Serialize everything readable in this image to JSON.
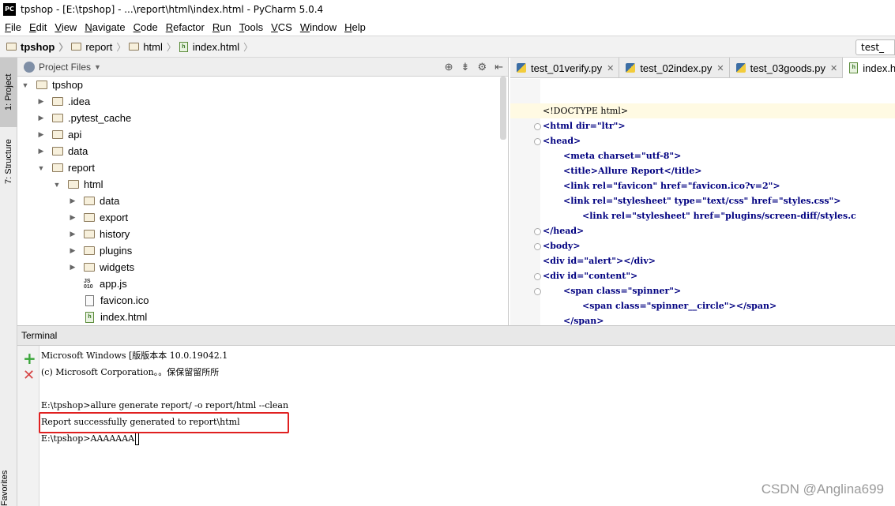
{
  "window": {
    "app_icon": "PC",
    "title": "tpshop - [E:\\tpshop] - ...\\report\\html\\index.html - PyCharm 5.0.4"
  },
  "menu": [
    {
      "mnemonic": "F",
      "rest": "ile"
    },
    {
      "mnemonic": "E",
      "rest": "dit"
    },
    {
      "mnemonic": "V",
      "rest": "iew"
    },
    {
      "mnemonic": "N",
      "rest": "avigate"
    },
    {
      "mnemonic": "C",
      "rest": "ode"
    },
    {
      "mnemonic": "R",
      "rest": "efactor"
    },
    {
      "mnemonic": "R",
      "rest": "un"
    },
    {
      "mnemonic": "T",
      "rest": "ools"
    },
    {
      "mnemonic": "V",
      "rest": "CS"
    },
    {
      "mnemonic": "W",
      "rest": "indow"
    },
    {
      "mnemonic": "H",
      "rest": "elp"
    }
  ],
  "breadcrumb": [
    "tpshop",
    "report",
    "html",
    "index.html"
  ],
  "navbar_right_tab": "test_",
  "sidebar": {
    "project_tab": "1: Project",
    "structure_tab": "7: Structure",
    "favorites_tab": "Favorites"
  },
  "project_panel": {
    "view_label": "Project Files",
    "tree": [
      {
        "label": "tpshop",
        "type": "folder",
        "expanded": true
      },
      {
        "label": ".idea",
        "type": "folder"
      },
      {
        "label": ".pytest_cache",
        "type": "folder"
      },
      {
        "label": "api",
        "type": "folder"
      },
      {
        "label": "data",
        "type": "folder"
      },
      {
        "label": "report",
        "type": "folder",
        "expanded": true
      },
      {
        "label": "html",
        "type": "folder",
        "expanded": true
      },
      {
        "label": "data",
        "type": "folder"
      },
      {
        "label": "export",
        "type": "folder"
      },
      {
        "label": "history",
        "type": "folder"
      },
      {
        "label": "plugins",
        "type": "folder"
      },
      {
        "label": "widgets",
        "type": "folder"
      },
      {
        "label": "app.js",
        "type": "js"
      },
      {
        "label": "favicon.ico",
        "type": "ico"
      },
      {
        "label": "index.html",
        "type": "html"
      }
    ]
  },
  "editor": {
    "tabs": [
      {
        "label": "test_01verify.py"
      },
      {
        "label": "test_02index.py"
      },
      {
        "label": "test_03goods.py"
      },
      {
        "label": "index.h"
      }
    ],
    "lines": [
      "<!DOCTYPE html>",
      "<html dir=\"ltr\">",
      "<head>",
      "<meta charset=\"utf-8\">",
      "<title>Allure Report</title>",
      "<link rel=\"favicon\" href=\"favicon.ico?v=2\">",
      "<link rel=\"stylesheet\" type=\"text/css\" href=\"styles.css\">",
      "<link rel=\"stylesheet\" href=\"plugins/screen-diff/styles.c",
      "</head>",
      "<body>",
      "<div id=\"alert\"></div>",
      "<div id=\"content\">",
      "<span class=\"spinner\">",
      "<span class=\"spinner__circle\"></span>",
      "</span>"
    ]
  },
  "terminal": {
    "title": "Terminal",
    "lines": [
      "Microsoft Windows [版版本本 10.0.19042.1",
      "(c) Microsoft Corporation。。保保留留所所",
      "",
      "E:\\tpshop>allure generate report/ -o report/html --clean",
      "Report successfully generated to report\\html",
      "E:\\tpshop>AAAAAAA"
    ]
  },
  "watermark": "CSDN @Anglina699"
}
